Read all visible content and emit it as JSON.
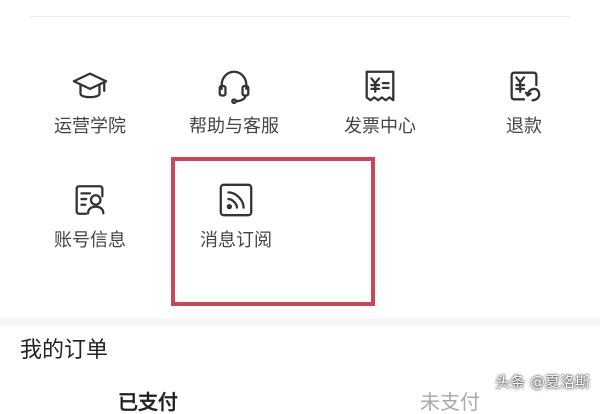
{
  "colors": {
    "icon_stroke": "#333333",
    "label_text": "#444444",
    "highlight": "#c8475b",
    "divider": "#f6f6f6"
  },
  "service_grid": {
    "items": [
      {
        "label": "运营学院",
        "icon": "graduation-cap-icon"
      },
      {
        "label": "帮助与客服",
        "icon": "headset-icon"
      },
      {
        "label": "发票中心",
        "icon": "invoice-receipt-icon"
      },
      {
        "label": "退款",
        "icon": "refund-yen-icon"
      },
      {
        "label": "账号信息",
        "icon": "account-card-icon"
      },
      {
        "label": "消息订阅",
        "icon": "rss-feed-icon"
      }
    ]
  },
  "orders": {
    "title": "我的订单",
    "partial_left": "已支付",
    "partial_right": "未支付"
  },
  "watermark": {
    "text": "头条 @夏洛斯"
  }
}
